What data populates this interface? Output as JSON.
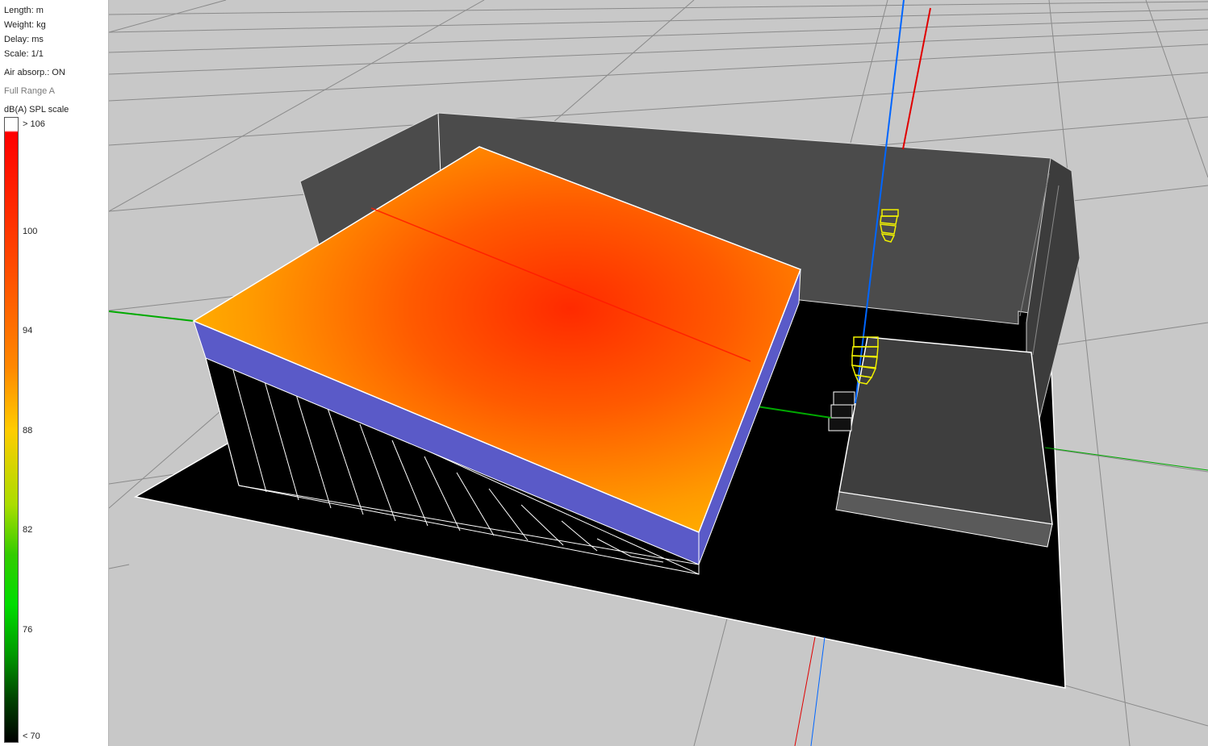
{
  "info": {
    "length": "Length: m",
    "weight": "Weight: kg",
    "delay": "Delay: ms",
    "scale": "Scale: 1/1",
    "air_absorption": "Air absorp.: ON",
    "frequency_range": "Full Range A",
    "spl_scale_title": "dB(A) SPL scale"
  },
  "spl_scale": {
    "ticks": [
      "> 106",
      "100",
      "94",
      "88",
      "82",
      "76",
      "< 70"
    ]
  },
  "colors": {
    "background": "#c8c8c8",
    "venue_floor": "#000000",
    "stage_walls": "#4b4b4b",
    "audience_side": "#5a5ac8",
    "speaker_outline": "#f0f000",
    "axis_x": "#e00000",
    "axis_y": "#009900",
    "axis_z": "#0066ff"
  }
}
